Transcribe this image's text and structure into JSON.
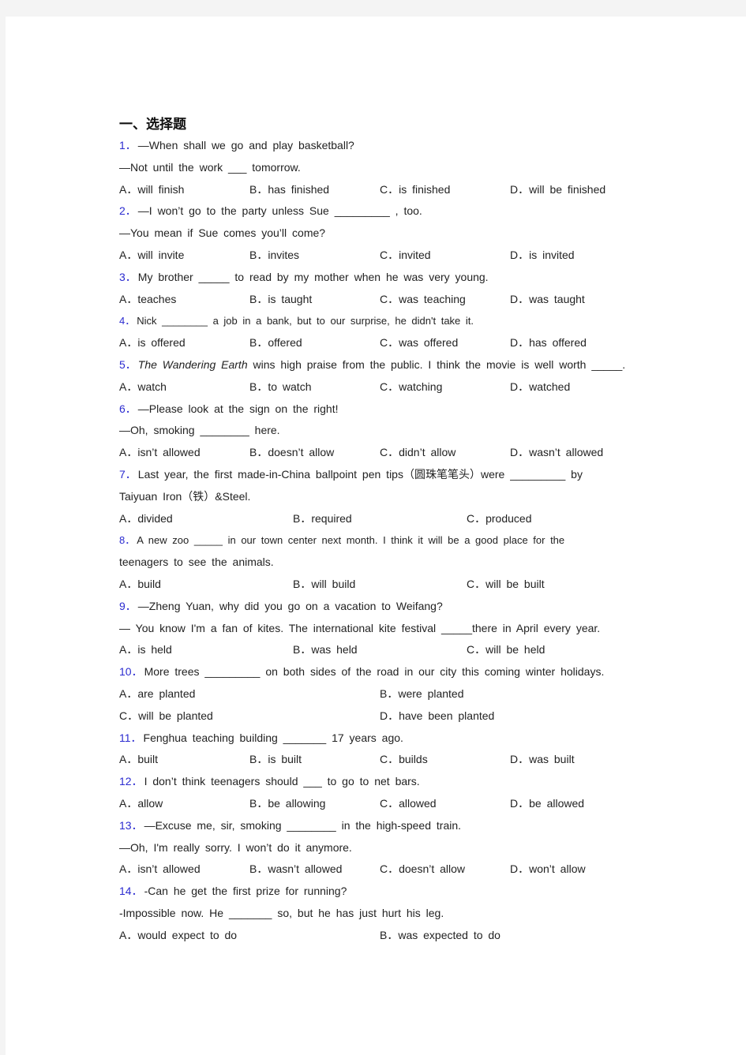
{
  "section": {
    "title": "一、选择题"
  },
  "questions": [
    {
      "num": "1．",
      "lines": [
        "—When shall we go and play basketball?",
        "—Not until the work ___ tomorrow."
      ],
      "options": [
        "A．will finish",
        "B．has finished",
        "C．is finished",
        "D．will be finished"
      ]
    },
    {
      "num": "2．",
      "lines": [
        "—I won’t go to the party unless Sue _________ , too.",
        "—You mean if Sue comes you’ll come?"
      ],
      "options": [
        "A．will invite",
        "B．invites",
        "C．invited",
        "D．is invited"
      ]
    },
    {
      "num": "3．",
      "lines": [
        "My brother _____ to read by my mother when he was very young."
      ],
      "options": [
        "A．teaches",
        "B．is taught",
        "C．was teaching",
        "D．was taught"
      ]
    },
    {
      "num": "4．",
      "lines": [
        "Nick ________ a job in a bank, but to our surprise, he didn't take it."
      ],
      "options": [
        "A．is offered",
        "B．offered",
        "C．was offered",
        "D．has offered"
      ]
    },
    {
      "num": "5．",
      "italic": "The Wandering Earth",
      "lines": [
        "wins high praise from the public. I think the movie is well worth _____."
      ],
      "options": [
        "A．watch",
        "B．to watch",
        "C．watching",
        "D．watched"
      ]
    },
    {
      "num": "6．",
      "lines": [
        "—Please look at the sign on the right!",
        "—Oh, smoking ________ here."
      ],
      "options": [
        "A．isn’t allowed",
        "B．doesn’t allow",
        "C．didn’t allow",
        "D．wasn’t allowed"
      ]
    },
    {
      "num": "7．",
      "lines": [
        "Last year, the first made-in-China ballpoint pen tips（圆珠笔笔头）were _________ by",
        "Taiyuan Iron（铁）&Steel."
      ],
      "options": [
        "A．divided",
        "B．required",
        "C．produced"
      ]
    },
    {
      "num": "8．",
      "lines": [
        "A new zoo _____ in our town center next month. I think it will be a good place for the",
        "teenagers to see the animals."
      ],
      "options": [
        "A．build",
        "B．will build",
        "C．will be built"
      ]
    },
    {
      "num": "9．",
      "lines": [
        "—Zheng Yuan, why did you go on a vacation to Weifang?",
        "— You know I'm a fan of kites. The international kite festival _____there in April every year."
      ],
      "options": [
        "A．is held",
        "B．was held",
        "C．will be held"
      ]
    },
    {
      "num": "10．",
      "lines": [
        "More trees _________ on both sides of the road in our city this coming winter holidays."
      ],
      "options": [
        "A．are planted",
        "B．were planted",
        "C．will be planted",
        "D．have been planted"
      ]
    },
    {
      "num": "11．",
      "lines": [
        "Fenghua teaching building _______ 17 years ago."
      ],
      "options": [
        "A．built",
        "B．is built",
        "C．builds",
        "D．was built"
      ]
    },
    {
      "num": "12．",
      "lines": [
        "I don’t think teenagers should ___ to go to net bars."
      ],
      "options": [
        "A．allow",
        "B．be allowing",
        "C．allowed",
        "D．be allowed"
      ]
    },
    {
      "num": "13．",
      "lines": [
        "—Excuse me, sir, smoking ________ in the high-speed train.",
        "—Oh, I'm really sorry. I won’t do it anymore."
      ],
      "options": [
        "A．isn’t allowed",
        "B．wasn’t allowed",
        "C．doesn’t allow",
        "D．won’t allow"
      ]
    },
    {
      "num": "14．",
      "lines": [
        "-Can he get the first prize for running?",
        "-Impossible now. He _______ so, but he has just hurt his leg."
      ],
      "options": [
        "A．would expect to do",
        "B．was expected to do"
      ]
    }
  ],
  "colors": {
    "question_number": "#2b2bd0",
    "text": "#222222",
    "background": "#f4f4f4",
    "page": "#ffffff"
  }
}
